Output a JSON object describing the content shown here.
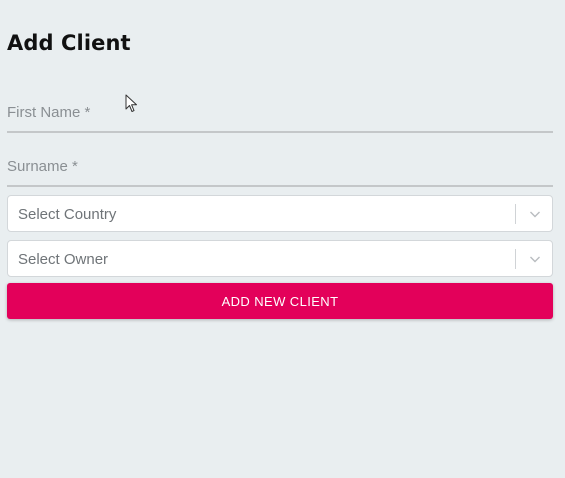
{
  "page": {
    "title": "Add Client"
  },
  "form": {
    "first_name_label": "First Name *",
    "first_name_value": "",
    "surname_label": "Surname *",
    "surname_value": "",
    "country_placeholder": "Select Country",
    "owner_placeholder": "Select Owner",
    "submit_label": "ADD NEW CLIENT"
  },
  "icons": {
    "select_arrow": "chevron-down-icon",
    "pointer": "mouse-cursor-icon"
  },
  "colors": {
    "background": "#e9eef0",
    "accent": "#e3005a",
    "field_underline": "#c4c7c9"
  }
}
